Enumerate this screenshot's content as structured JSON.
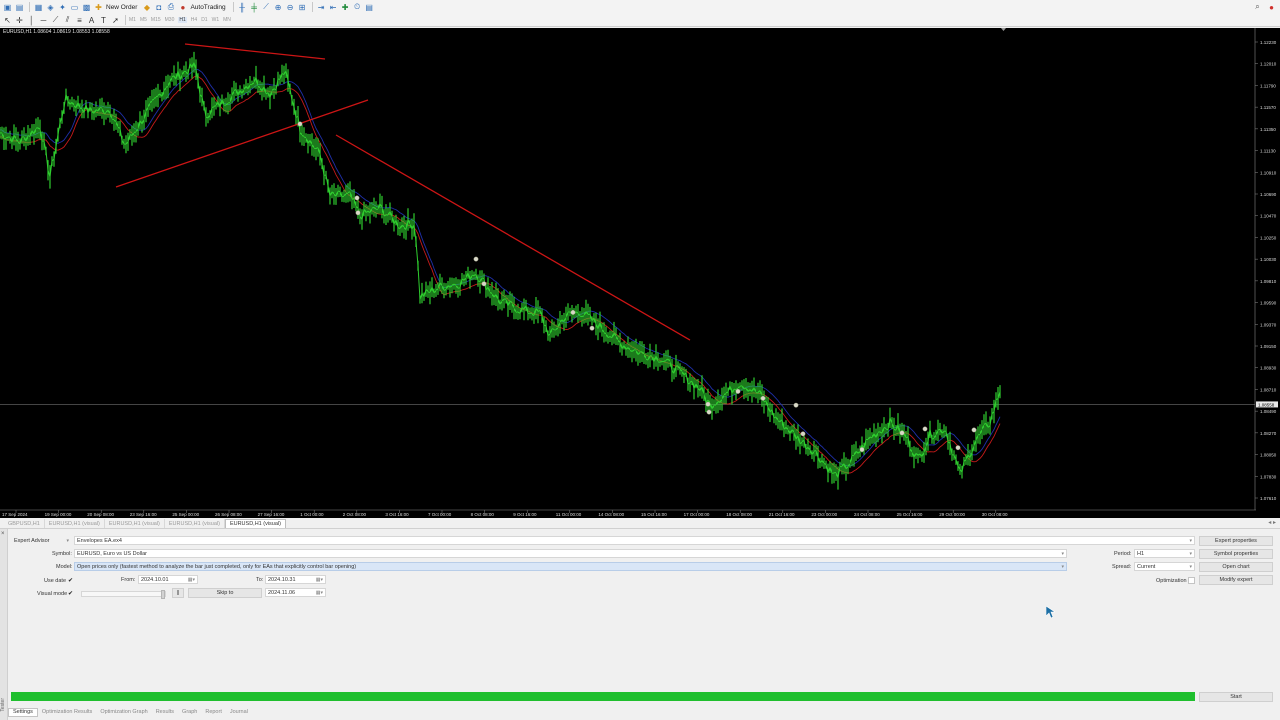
{
  "toolbar": {
    "new_order_label": "New Order",
    "autotrading_label": "AutoTrading",
    "timeframes": [
      "M1",
      "M5",
      "M15",
      "M30",
      "H1",
      "H4",
      "D1",
      "W1",
      "MN"
    ],
    "active_timeframe": "H1"
  },
  "chart": {
    "info": "EURUSD,H1  1.08604 1.08619 1.08553 1.08558",
    "price_labels": [
      "1.12230",
      "1.12010",
      "1.11790",
      "1.11570",
      "1.11350",
      "1.11130",
      "1.10910",
      "1.10690",
      "1.10470",
      "1.10250",
      "1.10030",
      "1.09810",
      "1.09590",
      "1.09370",
      "1.09150",
      "1.08930",
      "1.08710",
      "1.08490",
      "1.08270",
      "1.08050",
      "1.07830",
      "1.07610"
    ],
    "current_price": "1.08558",
    "time_labels": [
      "17 Sep 2024",
      "19 Sep 00:00",
      "20 Sep 08:00",
      "23 Sep 16:00",
      "25 Sep 00:00",
      "26 Sep 08:00",
      "27 Sep 16:00",
      "1 Oct 00:00",
      "2 Oct 08:00",
      "3 Oct 16:00",
      "7 Oct 00:00",
      "8 Oct 08:00",
      "9 Oct 16:00",
      "11 Oct 00:00",
      "14 Oct 08:00",
      "15 Oct 16:00",
      "17 Oct 00:00",
      "18 Oct 08:00",
      "21 Oct 16:00",
      "23 Oct 00:00",
      "24 Oct 08:00",
      "25 Oct 16:00",
      "29 Oct 00:00",
      "30 Oct 08:00"
    ],
    "colors": {
      "price": "#2ecc2e",
      "upper_band": "#1f2fa8",
      "lower_band": "#c41a1a",
      "trendline": "#cc1515",
      "marker": "#d8d8c8"
    }
  },
  "chart_tabs": [
    "GBPUSD,H1",
    "EURUSD,H1 (visual)",
    "EURUSD,H1 (visual)",
    "EURUSD,H1 (visual)",
    "EURUSD,H1 (visual)"
  ],
  "tester": {
    "side_label": "Tester",
    "expert_mode": "Expert Advisor",
    "expert_value": "Envelopes EA.ex4",
    "symbol_label": "Symbol:",
    "symbol_value": "EURUSD, Euro vs US Dollar",
    "model_label": "Model:",
    "model_value": "Open prices only (fastest method to analyze the bar just completed, only for EAs that explicitly control bar opening)",
    "use_date_label": "Use date",
    "from_label": "From:",
    "from_value": "2024.10.01",
    "to_label": "To:",
    "to_value": "2024.10.31",
    "visual_mode_label": "Visual mode",
    "pause_label": "||",
    "skip_to_label": "Skip to",
    "skip_to_value": "2024.11.06",
    "period_label": "Period:",
    "period_value": "H1",
    "spread_label": "Spread:",
    "spread_value": "Current",
    "optimization_label": "Optimization",
    "buttons": {
      "expert_properties": "Expert properties",
      "symbol_properties": "Symbol properties",
      "open_chart": "Open chart",
      "modify_expert": "Modify expert",
      "start": "Start"
    },
    "progress_percent": 100,
    "tabs": [
      "Settings",
      "Optimization Results",
      "Optimization Graph",
      "Results",
      "Graph",
      "Report",
      "Journal"
    ],
    "active_tab": "Settings"
  }
}
